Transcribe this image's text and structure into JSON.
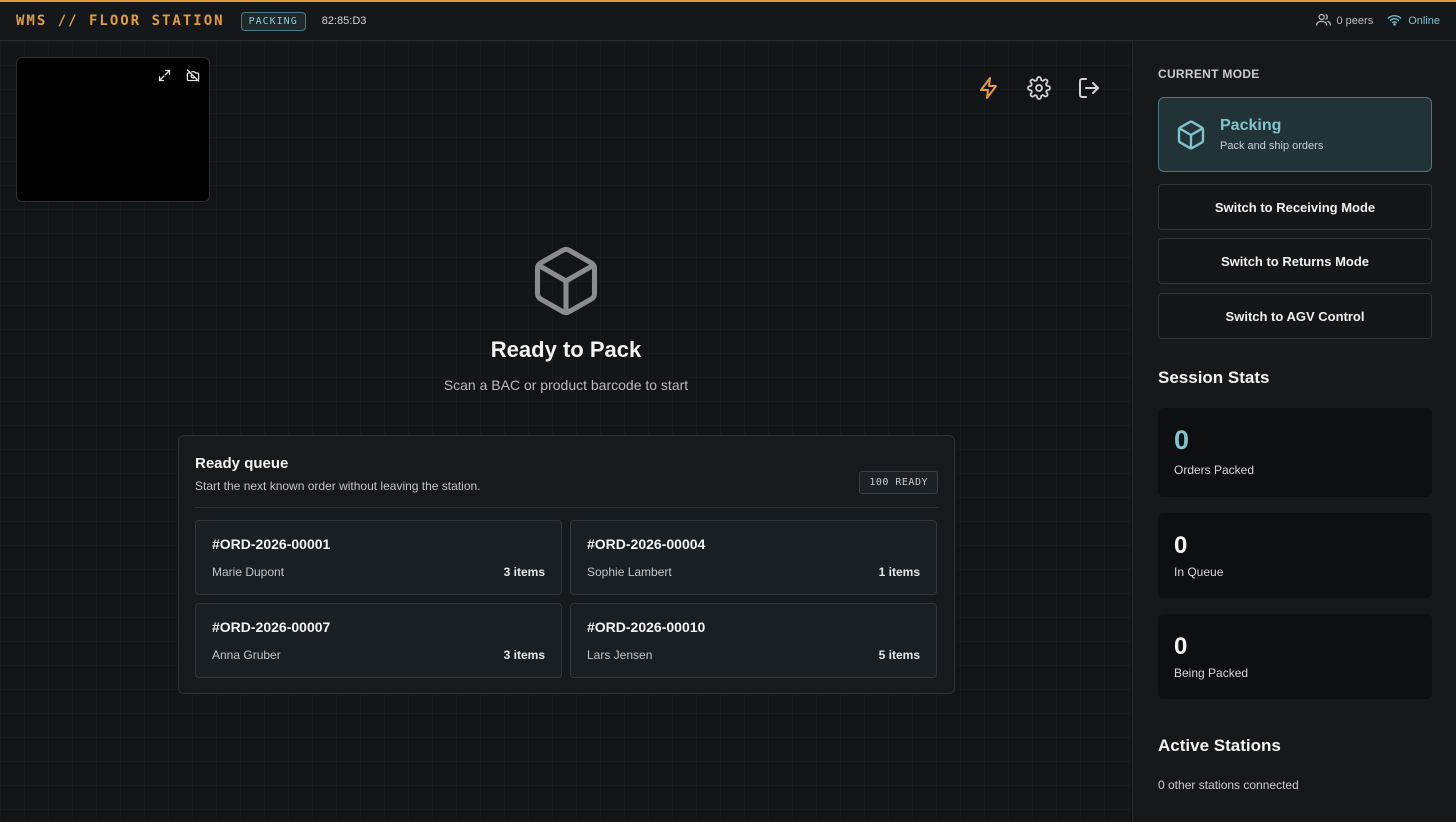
{
  "header": {
    "brand": "WMS // FLOOR STATION",
    "mode_badge": "PACKING",
    "station_id": "82:85:D3",
    "peers": "0 peers",
    "connection": "Online"
  },
  "colors": {
    "accent": "#e39a3b",
    "teal": "#7fc3cc",
    "background": "#121517"
  },
  "camera": {
    "icons": [
      "expand-icon",
      "camera-off-icon"
    ]
  },
  "toolbar": {
    "icons": [
      "lightning-icon",
      "gear-icon",
      "logout-icon"
    ]
  },
  "hero": {
    "title": "Ready to Pack",
    "subtitle": "Scan a BAC or product barcode to start"
  },
  "queue": {
    "title": "Ready queue",
    "subtitle": "Start the next known order without leaving the station.",
    "badge": "100 READY",
    "orders": [
      {
        "id": "#ORD-2026-00001",
        "customer": "Marie Dupont",
        "items": "3 items"
      },
      {
        "id": "#ORD-2026-00004",
        "customer": "Sophie Lambert",
        "items": "1 items"
      },
      {
        "id": "#ORD-2026-00007",
        "customer": "Anna Gruber",
        "items": "3 items"
      },
      {
        "id": "#ORD-2026-00010",
        "customer": "Lars Jensen",
        "items": "5 items"
      }
    ]
  },
  "sidebar": {
    "current_mode_label": "CURRENT MODE",
    "current_mode": {
      "title": "Packing",
      "subtitle": "Pack and ship orders"
    },
    "switch_buttons": [
      "Switch to Receiving Mode",
      "Switch to Returns Mode",
      "Switch to AGV Control"
    ],
    "session_stats_title": "Session Stats",
    "stats": [
      {
        "value": "0",
        "label": "Orders Packed"
      },
      {
        "value": "0",
        "label": "In Queue"
      },
      {
        "value": "0",
        "label": "Being Packed"
      }
    ],
    "active_stations_title": "Active Stations",
    "active_stations_text": "0 other stations connected"
  }
}
